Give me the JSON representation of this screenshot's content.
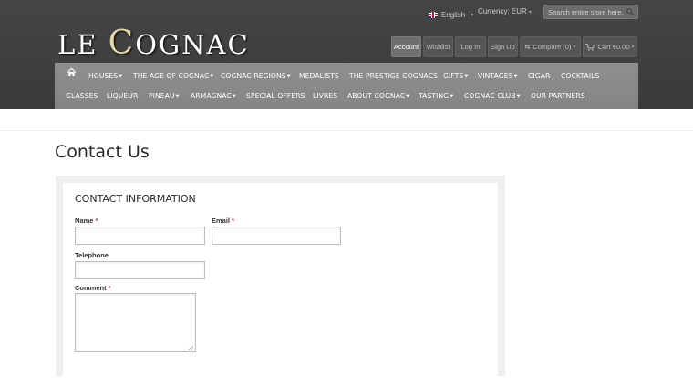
{
  "brand": {
    "logo_text_1": "L",
    "logo_text_2": "E ",
    "logo_text_3": "C",
    "logo_text_4": "OGNAC"
  },
  "topbar": {
    "language": "English",
    "currency_label": "Currency:",
    "currency_value": "EUR",
    "search_placeholder": "Search entire store here..."
  },
  "account_buttons": {
    "account": "Account",
    "wishlist": "Wishlist",
    "login": "Log In",
    "signup": "Sign Up",
    "compare": "Compare (0)",
    "cart": "Cart €0.00"
  },
  "nav": {
    "row1": [
      "Houses",
      "The Age of Cognac",
      "Cognac Regions",
      "Medalists",
      "The Prestige Cognacs",
      "Gifts",
      "Vintages",
      "Cigar",
      "Cocktails"
    ],
    "row2": [
      "Glasses",
      "Liqueur",
      "Pineau",
      "Armagnac",
      "Special Offers",
      "Livres",
      "About Cognac",
      "Tasting",
      "Cognac Club",
      "Our Partners"
    ]
  },
  "page": {
    "title": "Contact Us"
  },
  "form": {
    "section_title": "Contact Information",
    "name_label": "Name",
    "email_label": "Email",
    "telephone_label": "Telephone",
    "comment_label": "Comment",
    "required_mark": "*"
  },
  "colors": {
    "header_bg": "#3d3d3d",
    "nav_bg": "#8b8b8b",
    "required": "#d3222a"
  }
}
